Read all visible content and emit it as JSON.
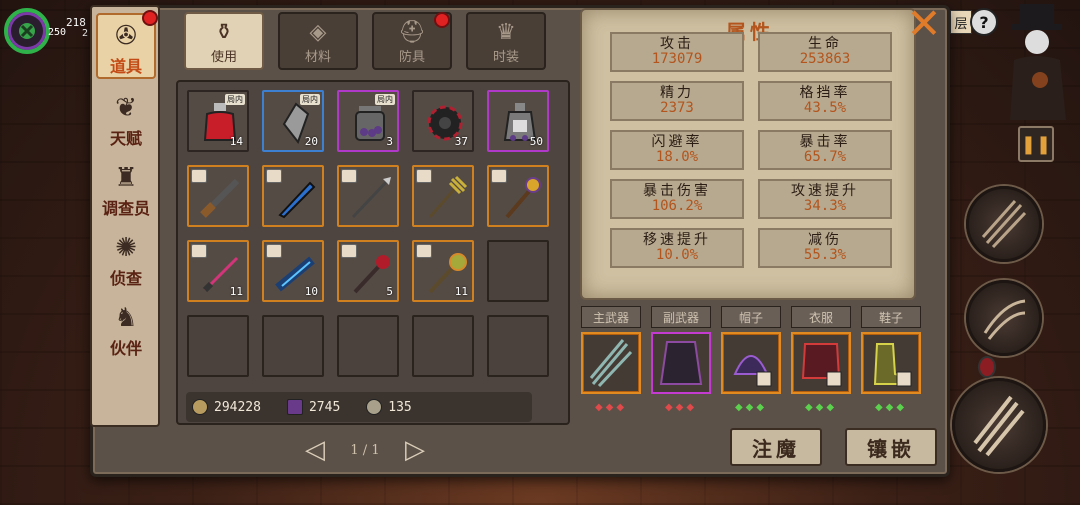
{
  "hud": {
    "top_number": "218",
    "sub_number": "250",
    "sub_number2": "2"
  },
  "help_label": "?",
  "top_right_tag": "层",
  "side_tabs": [
    {
      "label": "道具",
      "icon": "bag-icon"
    },
    {
      "label": "天赋",
      "icon": "talent-icon"
    },
    {
      "label": "调查员",
      "icon": "investigator-icon"
    },
    {
      "label": "侦查",
      "icon": "scout-icon"
    },
    {
      "label": "伙伴",
      "icon": "partner-icon"
    }
  ],
  "category_tabs": [
    {
      "label": "使用",
      "icon": "bottle-icon"
    },
    {
      "label": "材料",
      "icon": "material-icon"
    },
    {
      "label": "防具",
      "icon": "helmet-icon"
    },
    {
      "label": "时装",
      "icon": "hat-icon"
    }
  ],
  "inventory": {
    "rows": [
      [
        {
          "name": "red-potion",
          "count": "14",
          "tag": "局内",
          "rarity": "none"
        },
        {
          "name": "crystal-shard",
          "count": "20",
          "tag": "局内",
          "rarity": "blue"
        },
        {
          "name": "orb-jar",
          "count": "3",
          "tag": "局内",
          "rarity": "purple"
        },
        {
          "name": "dark-gear",
          "count": "37",
          "tag": "",
          "rarity": "none"
        },
        {
          "name": "potion-flask",
          "count": "50",
          "tag": "",
          "rarity": "purple"
        }
      ],
      [
        {
          "name": "dark-rifle",
          "count": "",
          "rarity": "orange"
        },
        {
          "name": "blue-blade",
          "count": "",
          "rarity": "orange"
        },
        {
          "name": "long-spear",
          "count": "",
          "rarity": "orange"
        },
        {
          "name": "trident",
          "count": "",
          "rarity": "orange"
        },
        {
          "name": "golden-staff",
          "count": "",
          "rarity": "orange"
        }
      ],
      [
        {
          "name": "crimson-sword",
          "count": "11",
          "rarity": "orange"
        },
        {
          "name": "frost-cannon",
          "count": "10",
          "rarity": "orange"
        },
        {
          "name": "blood-staff",
          "count": "5",
          "rarity": "orange"
        },
        {
          "name": "spirit-staff",
          "count": "11",
          "rarity": "orange"
        },
        {
          "name": "",
          "count": "",
          "rarity": "empty"
        }
      ],
      [
        {
          "name": "",
          "count": "",
          "rarity": "empty"
        },
        {
          "name": "",
          "count": "",
          "rarity": "empty"
        },
        {
          "name": "",
          "count": "",
          "rarity": "empty"
        },
        {
          "name": "",
          "count": "",
          "rarity": "empty"
        },
        {
          "name": "",
          "count": "",
          "rarity": "empty"
        }
      ]
    ]
  },
  "currency": [
    {
      "value": "294228",
      "icon": "gold-coin-icon"
    },
    {
      "value": "2745",
      "icon": "purple-book-icon"
    },
    {
      "value": "135",
      "icon": "silver-coin-icon"
    }
  ],
  "pager": {
    "text": "1 / 1"
  },
  "attributes": {
    "title": "属性",
    "items": [
      {
        "label": "攻击",
        "value": "173079"
      },
      {
        "label": "生命",
        "value": "253863"
      },
      {
        "label": "精力",
        "value": "2373"
      },
      {
        "label": "格挡率",
        "value": "43.5%"
      },
      {
        "label": "闪避率",
        "value": "18.0%"
      },
      {
        "label": "暴击率",
        "value": "65.7%"
      },
      {
        "label": "暴击伤害",
        "value": "106.2%"
      },
      {
        "label": "攻速提升",
        "value": "34.3%"
      },
      {
        "label": "移速提升",
        "value": "10.0%"
      },
      {
        "label": "减伤",
        "value": "55.3%"
      }
    ]
  },
  "equipment": [
    {
      "label": "主武器",
      "rarity": "orange",
      "dots": "◆◆◆",
      "dot_color": "#e04a4a"
    },
    {
      "label": "副武器",
      "rarity": "purple",
      "dots": "◆◆◆",
      "dot_color": "#e04a4a"
    },
    {
      "label": "帽子",
      "rarity": "orange",
      "dots": "◆◆◆",
      "dot_color": "#5bd14e"
    },
    {
      "label": "衣服",
      "rarity": "orange",
      "dots": "◆◆◆",
      "dot_color": "#5bd14e"
    },
    {
      "label": "鞋子",
      "rarity": "orange",
      "dots": "◆◆◆",
      "dot_color": "#5bd14e"
    }
  ],
  "actions": {
    "enchant": "注魔",
    "inlay": "镶嵌"
  },
  "colors": {
    "accent": "#b3551d",
    "close": "#e07b2a",
    "rarity_orange": "#d0801e",
    "rarity_purple": "#b039c9",
    "rarity_blue": "#3d7fd1"
  }
}
